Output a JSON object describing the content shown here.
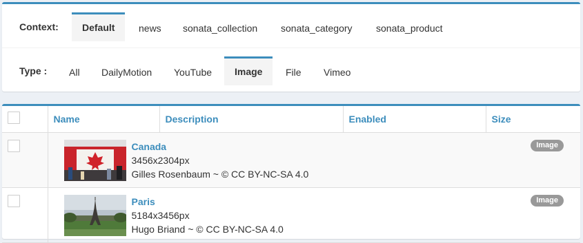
{
  "context": {
    "label": "Context:",
    "tabs": [
      {
        "label": "Default",
        "active": true
      },
      {
        "label": "news",
        "active": false
      },
      {
        "label": "sonata_collection",
        "active": false
      },
      {
        "label": "sonata_category",
        "active": false
      },
      {
        "label": "sonata_product",
        "active": false
      }
    ]
  },
  "type": {
    "label": "Type :",
    "tabs": [
      {
        "label": "All",
        "active": false
      },
      {
        "label": "DailyMotion",
        "active": false
      },
      {
        "label": "YouTube",
        "active": false
      },
      {
        "label": "Image",
        "active": true
      },
      {
        "label": "File",
        "active": false
      },
      {
        "label": "Vimeo",
        "active": false
      }
    ]
  },
  "table": {
    "columns": [
      "Name",
      "Description",
      "Enabled",
      "Size"
    ],
    "rows": [
      {
        "name": "Canada",
        "dimensions": "3456x2304px",
        "author": "Gilles Rosenbaum ~ © CC BY-NC-SA 4.0",
        "badge": "Image"
      },
      {
        "name": "Paris",
        "dimensions": "5184x3456px",
        "author": "Hugo Briand ~ © CC BY-NC-SA 4.0",
        "badge": "Image"
      }
    ]
  },
  "colors": {
    "accent": "#3c8dbc",
    "badge": "#999999",
    "active_tab_bg": "#f4f4f4"
  }
}
